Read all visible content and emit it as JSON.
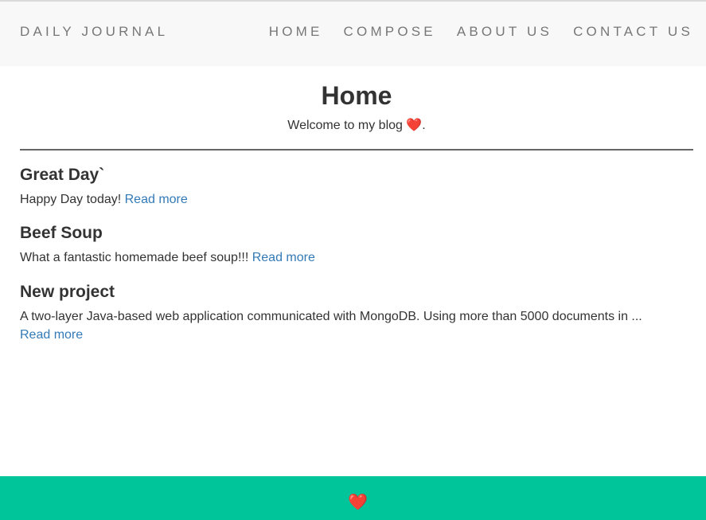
{
  "navbar": {
    "brand": "DAILY JOURNAL",
    "links": [
      "HOME",
      "COMPOSE",
      "ABOUT US",
      "CONTACT US"
    ]
  },
  "main": {
    "title": "Home",
    "welcome_text": "Welcome to my blog ",
    "welcome_heart": "❤️",
    "welcome_suffix": "."
  },
  "posts": [
    {
      "title": "Great Day`",
      "excerpt": "Happy Day today! ",
      "read_more": "Read more"
    },
    {
      "title": "Beef Soup",
      "excerpt": "What a fantastic homemade beef soup!!! ",
      "read_more": "Read more"
    },
    {
      "title": "New project",
      "excerpt": "A two-layer Java-based web application communicated with MongoDB. Using more than 5000 documents in ...",
      "read_more": "Read more"
    }
  ],
  "footer": {
    "heart": "❤️",
    "icon": "heart-icon"
  },
  "colors": {
    "navbar_bg": "#f8f8f8",
    "nav_text": "#777777",
    "link": "#337ab7",
    "footer_bg": "#00c49a",
    "heart": "#e0202a"
  }
}
